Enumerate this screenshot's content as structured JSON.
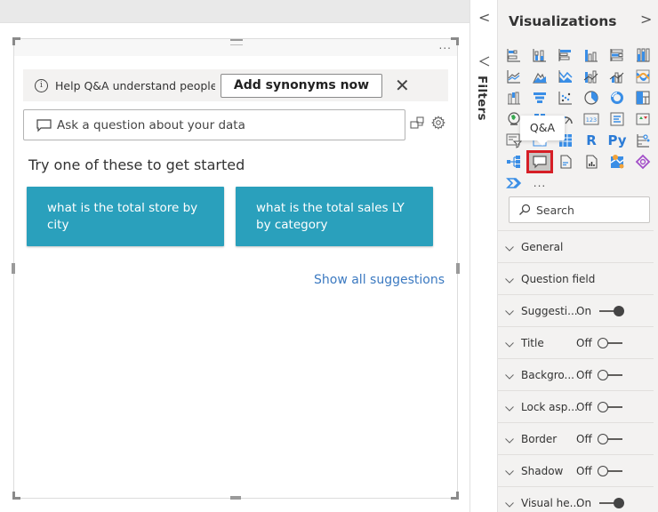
{
  "canvas": {
    "more_options_label": "...",
    "banner": {
      "text": "Help Q&A understand people's q...",
      "button_label": "Add synonyms now",
      "close_label": "✕"
    },
    "question_input": {
      "placeholder": "Ask a question about your data",
      "value": ""
    },
    "suggestions_title": "Try one of these to get started",
    "suggestions": [
      "what is the total store by city",
      "what is the total sales LY by category"
    ],
    "show_all_label": "Show all suggestions",
    "accent_color": "#2aa0bc"
  },
  "filters_pane": {
    "collapse_label": "<",
    "label": "Filters"
  },
  "visualizations_pane": {
    "title": "Visualizations",
    "expand_label": ">",
    "tooltip": "Q&A",
    "selected_visual": "qa",
    "visuals": [
      "stacked-bar-chart",
      "stacked-column-chart",
      "clustered-bar-chart",
      "clustered-column-chart",
      "100-stacked-bar-chart",
      "100-stacked-column-chart",
      "line-chart",
      "area-chart",
      "stacked-area-chart",
      "line-and-stacked-column-chart",
      "line-and-clustered-column-chart",
      "ribbon-chart",
      "waterfall-chart",
      "funnel-chart",
      "scatter-chart",
      "pie-chart",
      "donut-chart",
      "treemap",
      "map",
      "filled-map",
      "gauge",
      "card",
      "multi-row-card",
      "kpi",
      "slicer",
      "table",
      "matrix",
      "r-script-visual",
      "python-visual",
      "key-influencers",
      "decomposition-tree",
      "qa",
      "smart-narrative",
      "paginated-report",
      "arcgis-map",
      "power-apps",
      "power-automate",
      "more-visuals"
    ],
    "r_label": "R",
    "py_label": "Py",
    "more_label": "...",
    "search": {
      "placeholder": "Search",
      "value": ""
    },
    "sections": [
      {
        "label": "General"
      },
      {
        "label": "Question field"
      },
      {
        "label": "Suggesti...",
        "state": "On",
        "on": true
      },
      {
        "label": "Title",
        "state": "Off",
        "on": false
      },
      {
        "label": "Backgro...",
        "state": "Off",
        "on": false
      },
      {
        "label": "Lock asp...",
        "state": "Off",
        "on": false
      },
      {
        "label": "Border",
        "state": "Off",
        "on": false
      },
      {
        "label": "Shadow",
        "state": "Off",
        "on": false
      },
      {
        "label": "Visual he...",
        "state": "On",
        "on": true
      }
    ],
    "selection_color": "#d61f26"
  }
}
